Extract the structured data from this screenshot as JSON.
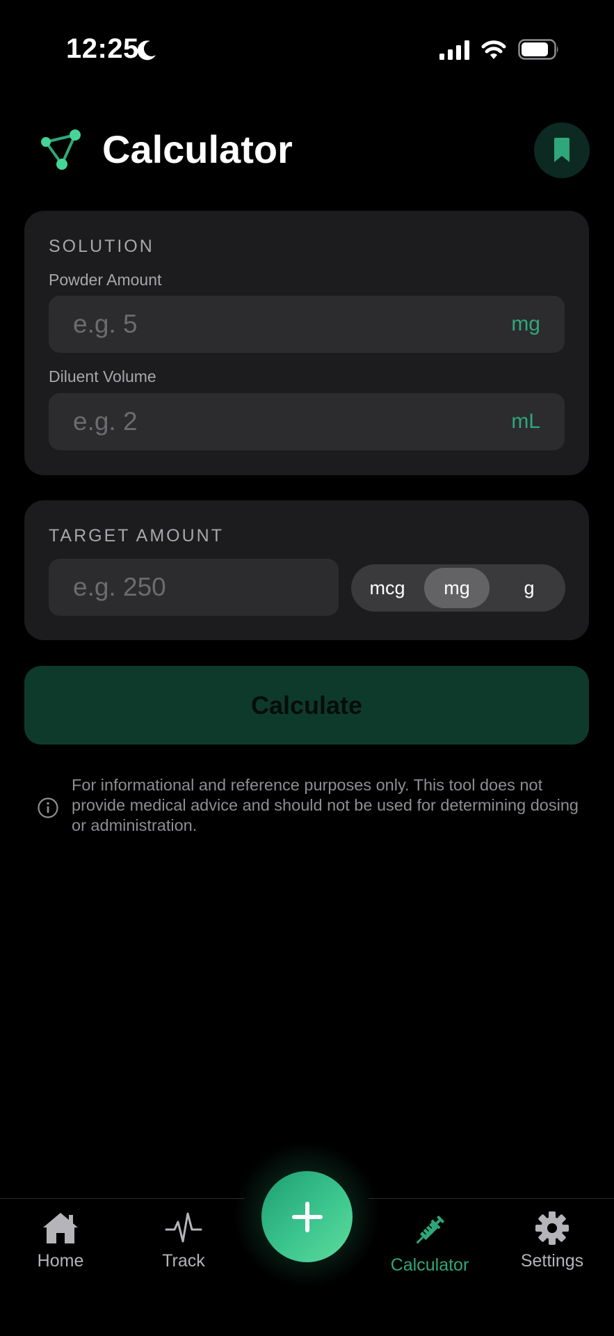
{
  "status_bar": {
    "time": "12:25",
    "icons": [
      "moon-icon",
      "signal-icon",
      "wifi-icon",
      "battery-icon"
    ]
  },
  "header": {
    "title": "Calculator",
    "logo_icon": "molecule-logo-icon",
    "bookmark_icon": "bookmark-icon"
  },
  "solution": {
    "section_title": "SOLUTION",
    "powder": {
      "label": "Powder Amount",
      "placeholder": "e.g. 5",
      "value": "",
      "unit": "mg"
    },
    "diluent": {
      "label": "Diluent Volume",
      "placeholder": "e.g. 2",
      "value": "",
      "unit": "mL"
    }
  },
  "target": {
    "section_title": "TARGET AMOUNT",
    "placeholder": "e.g. 250",
    "value": "",
    "units": [
      "mcg",
      "mg",
      "g"
    ],
    "selected_unit": "mg"
  },
  "calculate_label": "Calculate",
  "disclaimer": "For informational and reference purposes only. This tool does not provide medical advice and should not be used for determining dosing or administration.",
  "tabs": [
    {
      "label": "Home",
      "icon": "home-icon",
      "active": false
    },
    {
      "label": "Track",
      "icon": "pulse-icon",
      "active": false
    },
    {
      "label": "Calculator",
      "icon": "syringe-icon",
      "active": true
    },
    {
      "label": "Settings",
      "icon": "gear-icon",
      "active": false
    }
  ],
  "fab_icon": "plus-icon",
  "colors": {
    "accent": "#2fa77a",
    "background": "#000000",
    "card": "#1c1c1e",
    "input": "#2c2c2e",
    "calculate_button": "#0e3a2c"
  }
}
